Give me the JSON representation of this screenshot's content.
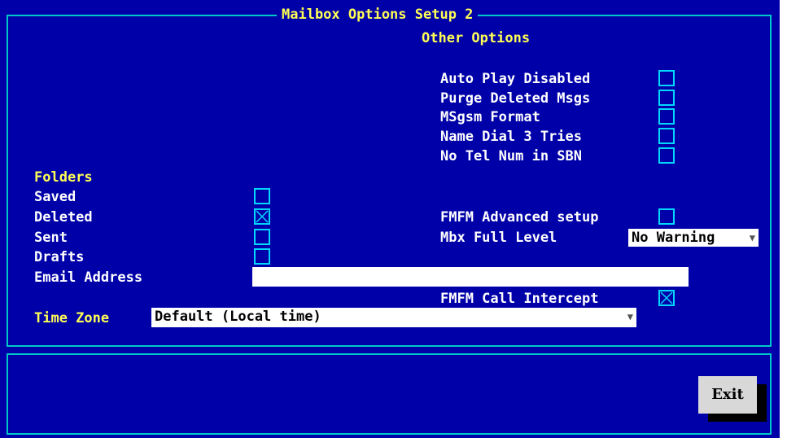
{
  "title": "Mailbox Options Setup 2",
  "other_options": {
    "heading": "Other Options",
    "items": [
      {
        "label": "Auto Play Disabled",
        "checked": false
      },
      {
        "label": "Purge Deleted Msgs",
        "checked": false
      },
      {
        "label": "MSgsm Format",
        "checked": false
      },
      {
        "label": "Name Dial 3 Tries",
        "checked": false
      },
      {
        "label": "No Tel Num in SBN",
        "checked": false
      }
    ]
  },
  "folders": {
    "heading": "Folders",
    "items": [
      {
        "label": "Saved",
        "checked": false
      },
      {
        "label": "Deleted",
        "checked": true
      },
      {
        "label": "Sent",
        "checked": false
      },
      {
        "label": "Drafts",
        "checked": false
      }
    ]
  },
  "fmfm_advanced": {
    "label": "FMFM Advanced setup",
    "checked": false
  },
  "mbx_full_level": {
    "label": "Mbx Full Level",
    "value": "No Warning",
    "arrow": "▼"
  },
  "email": {
    "label": "Email Address",
    "value": ""
  },
  "fmfm_intercept": {
    "label": "FMFM Call Intercept",
    "checked": true
  },
  "time_zone": {
    "label": "Time Zone",
    "value": "Default (Local time)",
    "arrow": "▼"
  },
  "exit_label": "Exit",
  "colors": {
    "background": "#0000a8",
    "border": "#00c8c8",
    "heading": "#ffff55",
    "label": "#ffffff"
  }
}
